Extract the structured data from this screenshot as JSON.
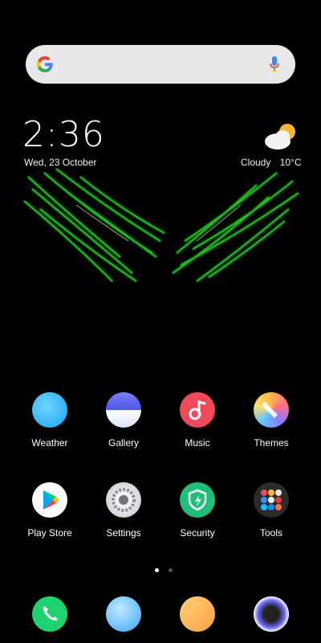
{
  "clock": {
    "time": "2:36",
    "date": "Wed, 23 October"
  },
  "weather": {
    "condition": "Cloudy",
    "temperature": "10°C",
    "icon": "cloud-sun-icon"
  },
  "search": {
    "logo": "google-icon",
    "mic": "mic-icon"
  },
  "apps_row1": [
    {
      "label": "Weather",
      "icon": "weather-app-icon"
    },
    {
      "label": "Gallery",
      "icon": "gallery-app-icon"
    },
    {
      "label": "Music",
      "icon": "music-app-icon"
    },
    {
      "label": "Themes",
      "icon": "themes-app-icon"
    }
  ],
  "apps_row2": [
    {
      "label": "Play Store",
      "icon": "play-store-icon"
    },
    {
      "label": "Settings",
      "icon": "settings-icon"
    },
    {
      "label": "Security",
      "icon": "security-icon"
    },
    {
      "label": "Tools",
      "icon": "tools-folder-icon"
    }
  ],
  "dock": [
    {
      "icon": "phone-icon"
    },
    {
      "icon": "messages-icon"
    },
    {
      "icon": "notes-icon"
    },
    {
      "icon": "camera-icon"
    }
  ],
  "page_indicator": {
    "pages": 2,
    "current": 1
  }
}
